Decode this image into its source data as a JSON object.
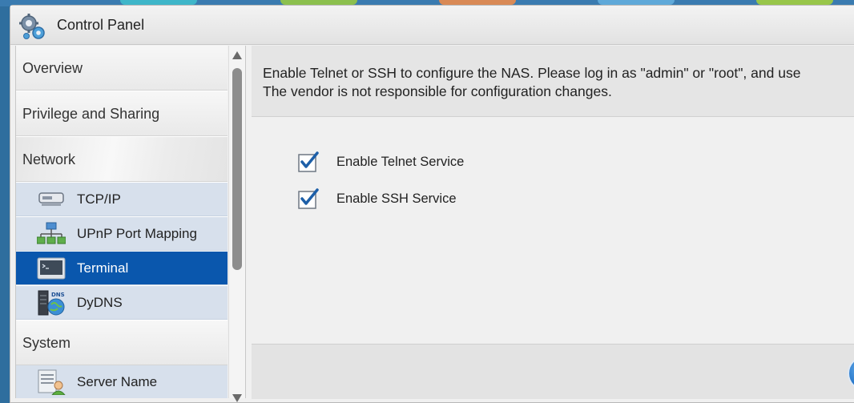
{
  "window": {
    "title": "Control Panel",
    "title_icon": "gears-icon"
  },
  "sidebar": {
    "categories": {
      "overview": "Overview",
      "privilege": "Privilege and Sharing",
      "network": "Network",
      "system": "System"
    },
    "network_items": [
      {
        "label": "TCP/IP",
        "icon": "network-adapter-icon"
      },
      {
        "label": "UPnP Port Mapping",
        "icon": "network-topology-icon"
      },
      {
        "label": "Terminal",
        "icon": "terminal-icon",
        "active": true
      },
      {
        "label": "DyDNS",
        "icon": "dns-server-icon"
      }
    ],
    "system_items": [
      {
        "label": "Server Name",
        "icon": "server-user-icon"
      }
    ]
  },
  "main": {
    "notice_line1": "Enable Telnet or SSH to configure the NAS. Please log in as \"admin\" or \"root\", and use",
    "notice_line2": "The vendor is not responsible for configuration changes.",
    "options": [
      {
        "label": "Enable Telnet Service",
        "checked": true
      },
      {
        "label": "Enable SSH Service",
        "checked": true
      }
    ]
  },
  "colors": {
    "accent": "#0a57ad",
    "submenu_bg": "#d7e0ec",
    "check": "#1d5fa8"
  }
}
